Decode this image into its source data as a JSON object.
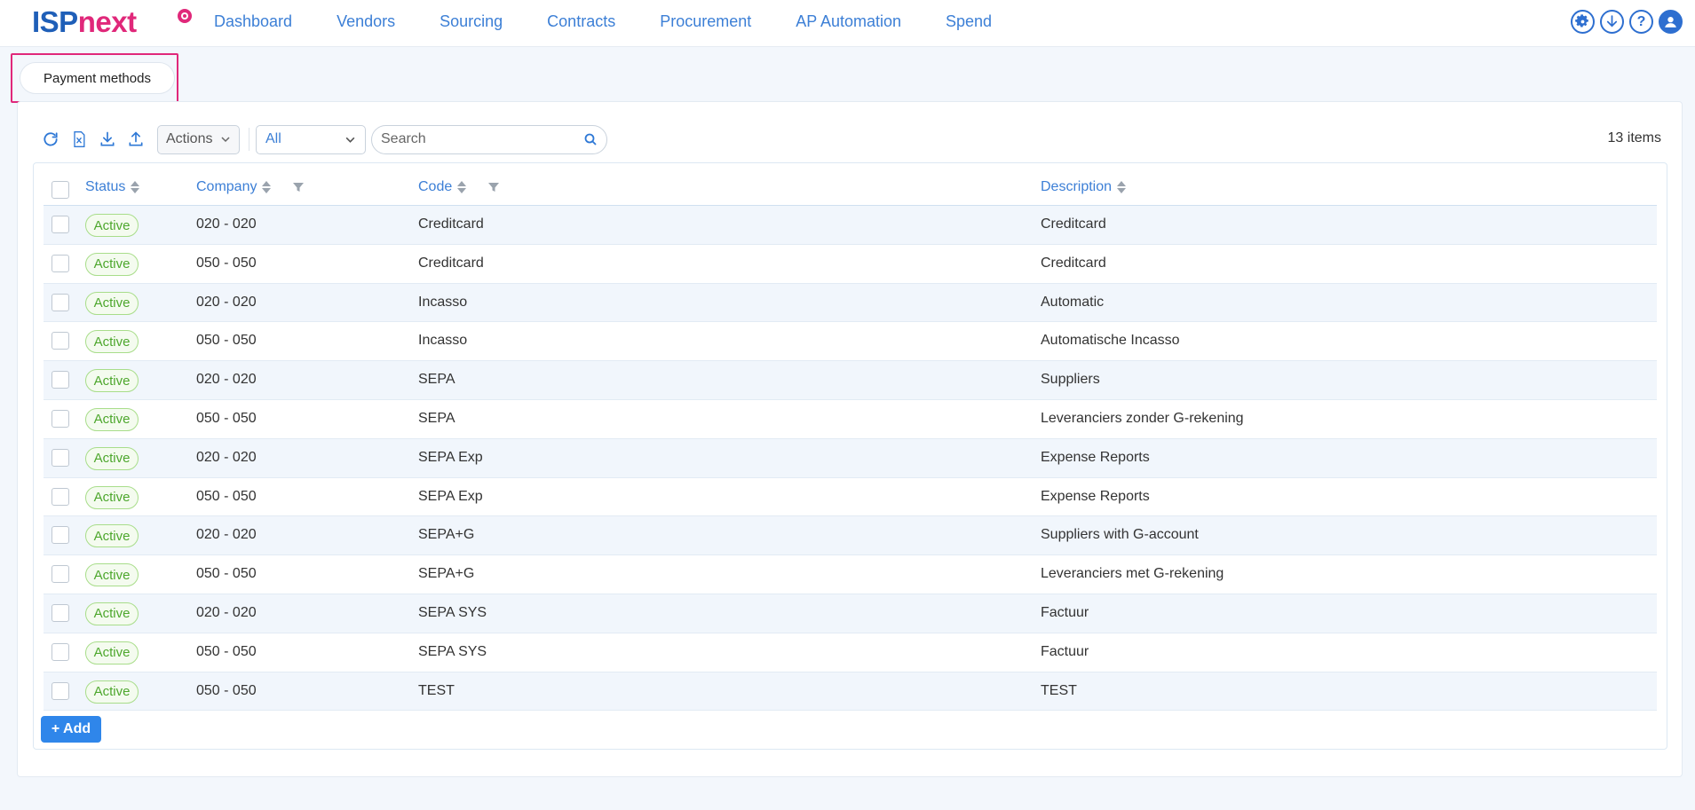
{
  "app": {
    "logo_isp": "ISP",
    "logo_next": "next"
  },
  "nav": {
    "items": [
      {
        "label": "Dashboard"
      },
      {
        "label": "Vendors"
      },
      {
        "label": "Sourcing"
      },
      {
        "label": "Contracts"
      },
      {
        "label": "Procurement"
      },
      {
        "label": "AP Automation"
      },
      {
        "label": "Spend"
      }
    ],
    "icons": [
      "gear-icon",
      "download-icon",
      "help-icon",
      "user-icon"
    ]
  },
  "tab": {
    "label": "Payment methods"
  },
  "toolbar": {
    "actions_label": "Actions",
    "filter_value": "All",
    "search_placeholder": "Search",
    "items_count": "13 items"
  },
  "table": {
    "columns": [
      {
        "label": "Status"
      },
      {
        "label": "Company"
      },
      {
        "label": "Code"
      },
      {
        "label": "Description"
      }
    ],
    "rows": [
      {
        "status": "Active",
        "company": "020 - 020",
        "code": "Creditcard",
        "description": "Creditcard"
      },
      {
        "status": "Active",
        "company": "050 - 050",
        "code": "Creditcard",
        "description": "Creditcard"
      },
      {
        "status": "Active",
        "company": "020 - 020",
        "code": "Incasso",
        "description": "Automatic"
      },
      {
        "status": "Active",
        "company": "050 - 050",
        "code": "Incasso",
        "description": "Automatische Incasso"
      },
      {
        "status": "Active",
        "company": "020 - 020",
        "code": "SEPA",
        "description": "Suppliers"
      },
      {
        "status": "Active",
        "company": "050 - 050",
        "code": "SEPA",
        "description": "Leveranciers zonder G-rekening"
      },
      {
        "status": "Active",
        "company": "020 - 020",
        "code": "SEPA Exp",
        "description": "Expense Reports"
      },
      {
        "status": "Active",
        "company": "050 - 050",
        "code": "SEPA Exp",
        "description": "Expense Reports"
      },
      {
        "status": "Active",
        "company": "020 - 020",
        "code": "SEPA+G",
        "description": "Suppliers with G-account"
      },
      {
        "status": "Active",
        "company": "050 - 050",
        "code": "SEPA+G",
        "description": "Leveranciers met G-rekening"
      },
      {
        "status": "Active",
        "company": "020 - 020",
        "code": "SEPA SYS",
        "description": "Factuur"
      },
      {
        "status": "Active",
        "company": "050 - 050",
        "code": "SEPA SYS",
        "description": "Factuur"
      },
      {
        "status": "Active",
        "company": "050 - 050",
        "code": "TEST",
        "description": "TEST"
      }
    ]
  },
  "footer": {
    "add_label": "+ Add"
  },
  "colors": {
    "accent": "#3c7fd6",
    "brand_pink": "#e0287a",
    "active_green": "#4da72d",
    "add_button": "#2f86ea"
  }
}
